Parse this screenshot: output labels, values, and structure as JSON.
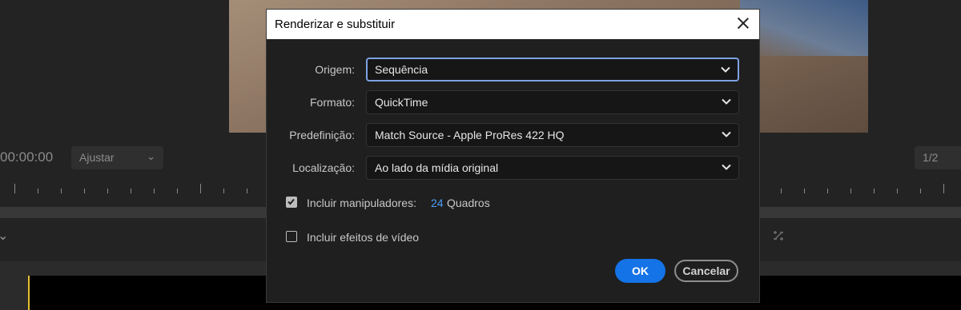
{
  "background": {
    "timecode": "00:00:00",
    "fit_select": "Ajustar",
    "page_indicator": "1/2"
  },
  "dialog": {
    "title": "Renderizar e substituir",
    "fields": [
      {
        "label": "Origem:",
        "value": "Sequência"
      },
      {
        "label": "Formato:",
        "value": "QuickTime"
      },
      {
        "label": "Predefinição:",
        "value": "Match Source - Apple ProRes 422 HQ"
      },
      {
        "label": "Localização:",
        "value": "Ao lado da mídia original"
      }
    ],
    "include_handles": {
      "label": "Incluir manipuladores:",
      "checked": true,
      "value": "24",
      "unit": "Quadros"
    },
    "include_effects": {
      "label": "Incluir efeitos de vídeo",
      "checked": false
    },
    "ok_label": "OK",
    "cancel_label": "Cancelar"
  },
  "colors": {
    "accent_button": "#1473e6",
    "link_value": "#4e9ef7",
    "focus_ring": "#7da2e3",
    "playhead": "#e6c230"
  },
  "icons": [
    "close-icon",
    "chevron-down-icon",
    "checkmark-icon",
    "chevron-icon"
  ]
}
